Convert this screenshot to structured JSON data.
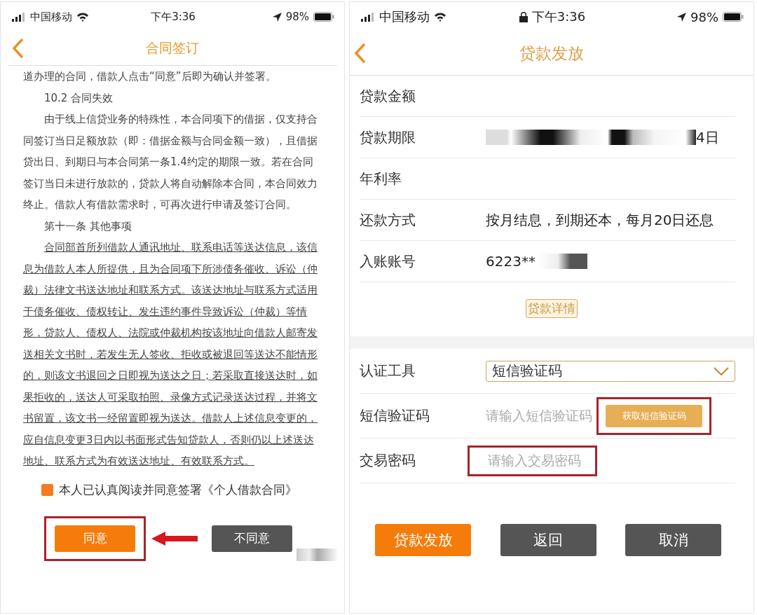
{
  "left": {
    "status_bar": {
      "carrier": "中国移动",
      "time": "下午3:36",
      "battery": "98%"
    },
    "nav": {
      "title": "合同签订"
    },
    "paragraphs": [
      {
        "kind": "text",
        "indent": false,
        "text": "道办理的合同，借款人点击“同意”后即为确认并签署。"
      },
      {
        "kind": "text",
        "indent": true,
        "text": "10.2 合同失效"
      },
      {
        "kind": "text",
        "indent": true,
        "text": "由于线上信贷业务的特殊性，本合同项下的借据，仅支持合同签订当日足额放款（即：借据金额与合同金额一致），且借据贷出日、到期日与本合同第一条1.4约定的期限一致。若在合同签订当日未进行放款的，贷款人将自动解除本合同，本合同效力终止。借款人有借款需求时，可再次进行申请及签订合同。"
      },
      {
        "kind": "text",
        "indent": true,
        "text": "第十一条 其他事项"
      },
      {
        "kind": "underlined",
        "indent": true,
        "text": "合同部首所列借款人通讯地址、联系电话等送达信息，该信息为借款人本人所提供，且为合同项下所涉债务催收、诉讼（仲裁）法律文书送达地址和联系方式。该送达地址与联系方式适用于债务催收、债权转让、发生违约事件导致诉讼（仲裁）等情形，贷款人、债权人、法院或仲裁机构按该地址向借款人邮寄发送相关文书时，若发生无人签收、拒收或被退回等送达不能情形的，则该文书退回之日即视为送达之日；若采取直接送达时，如果拒收的，送达人可采取拍照、录像方式记录送达过程，并将文书留置，该文书一经留置即视为送达。借款人上述信息变更的，应自信息变更3日内以书面形式告知贷款人，否则仍以上述送达地址、联系方式为有效送达地址、有效联系方式。"
      }
    ],
    "consent": {
      "label": "本人已认真阅读并同意签署《个人借款合同》",
      "checked": true
    },
    "buttons": [
      {
        "kind": "primary",
        "label": "同意",
        "highlighted": true,
        "pointer": true,
        "redacted": false
      },
      {
        "kind": "secondary",
        "label": "不同意",
        "highlighted": false,
        "pointer": false,
        "redacted": true
      }
    ]
  },
  "right": {
    "status_bar": {
      "carrier": "中国移动",
      "time": "下午3:36",
      "battery": "98%",
      "lock": true
    },
    "nav": {
      "title": "贷款发放"
    },
    "rows": [
      {
        "label": "贷款金额",
        "redacted": false
      },
      {
        "label": "贷款期限",
        "value": "4日",
        "redacted": true
      },
      {
        "label": "年利率",
        "redacted": false
      },
      {
        "label": "还款方式",
        "value": "按月结息，到期还本，每月20日还息",
        "redacted": false
      },
      {
        "label": "入账账号",
        "value": "6223**",
        "redacted": true
      }
    ],
    "details_button": {
      "label": "贷款详情"
    },
    "auth": [
      {
        "kind": "select",
        "label": "认证工具",
        "value": "短信验证码"
      },
      {
        "kind": "code",
        "label": "短信验证码",
        "placeholder": "请输入短信验证码",
        "button": {
          "label": "获取短信验证码",
          "highlighted": true
        }
      },
      {
        "kind": "password",
        "label": "交易密码",
        "placeholder": "请输入交易密码",
        "highlighted": true
      }
    ],
    "buttons": [
      {
        "kind": "primary",
        "label": "贷款发放"
      },
      {
        "kind": "secondary",
        "label": "返回"
      },
      {
        "kind": "secondary",
        "label": "取消"
      }
    ]
  }
}
